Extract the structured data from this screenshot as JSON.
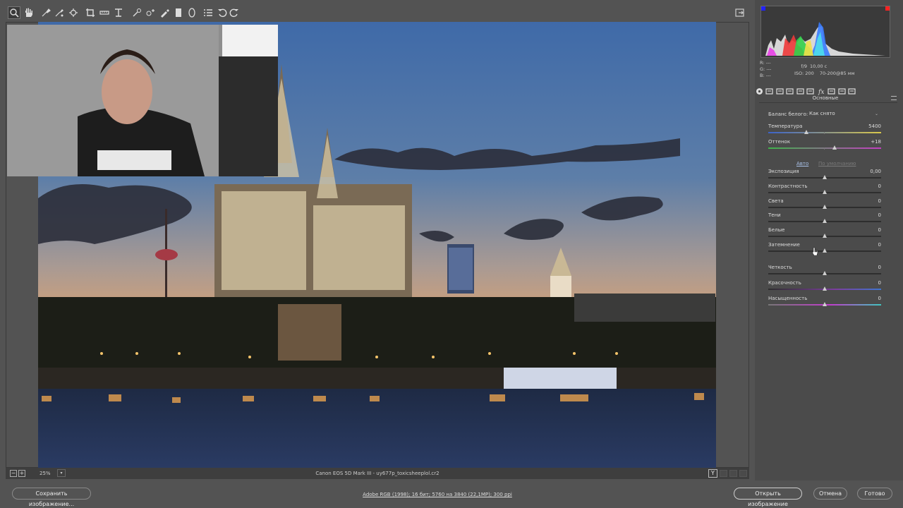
{
  "toolbar": {
    "tools": [
      "zoom-icon",
      "hand-icon",
      "white-balance-icon",
      "color-sampler-icon",
      "targeted-adjust-icon",
      "crop-icon",
      "straighten-icon",
      "transform-icon",
      "spot-removal-icon",
      "red-eye-icon",
      "adjustment-brush-icon",
      "graduated-filter-icon",
      "radial-filter-icon",
      "presets-list-icon",
      "rotate-ccw-icon",
      "rotate-cw-icon"
    ]
  },
  "statusbar": {
    "zoom": "25%",
    "file": "Canon EOS 5D Mark III  -  uy677p_toxicsheeplol.cr2",
    "view_toggle": "Y"
  },
  "panel": {
    "rgb": {
      "r_label": "R:",
      "g_label": "G:",
      "b_label": "B:",
      "r": "---",
      "g": "---",
      "b": "---"
    },
    "camera": {
      "aperture": "f/9",
      "shutter": "10,00 с",
      "iso": "ISO: 200",
      "lens": "70-200@85 мм"
    },
    "section_title": "Основные",
    "white_balance": {
      "label": "Баланс белого:",
      "value": "Как снято"
    },
    "auto_label": "Авто",
    "default_label": "По умолчанию",
    "sliders": [
      {
        "name": "temperature",
        "label": "Температура",
        "value": "5400",
        "level": 0.34
      },
      {
        "name": "tint",
        "label": "Оттенок",
        "value": "+18",
        "level": 0.59
      },
      {
        "name": "exposure",
        "label": "Экспозиция",
        "value": "0,00",
        "level": 0.5
      },
      {
        "name": "contrast",
        "label": "Контрастность",
        "value": "0",
        "level": 0.5
      },
      {
        "name": "highlights",
        "label": "Света",
        "value": "0",
        "level": 0.5
      },
      {
        "name": "shadows",
        "label": "Тени",
        "value": "0",
        "level": 0.5
      },
      {
        "name": "whites",
        "label": "Белые",
        "value": "0",
        "level": 0.5
      },
      {
        "name": "blacks",
        "label": "Затемнение",
        "value": "0",
        "level": 0.5
      },
      {
        "name": "clarity",
        "label": "Четкость",
        "value": "0",
        "level": 0.5
      },
      {
        "name": "vibrance",
        "label": "Красочность",
        "value": "0",
        "level": 0.5
      },
      {
        "name": "saturation",
        "label": "Насыщенность",
        "value": "0",
        "level": 0.5
      }
    ]
  },
  "bottom": {
    "save_label": "Сохранить изображение...",
    "workflow": "Adobe RGB (1998); 16 бит; 5760 на 3840 (22,1МР); 300 ppi",
    "open_label": "Открыть изображение",
    "cancel_label": "Отмена",
    "done_label": "Готово"
  },
  "colors": {
    "panel_bg": "#4b4b4b",
    "app_bg": "#535353",
    "link": "#a9c1e8"
  }
}
